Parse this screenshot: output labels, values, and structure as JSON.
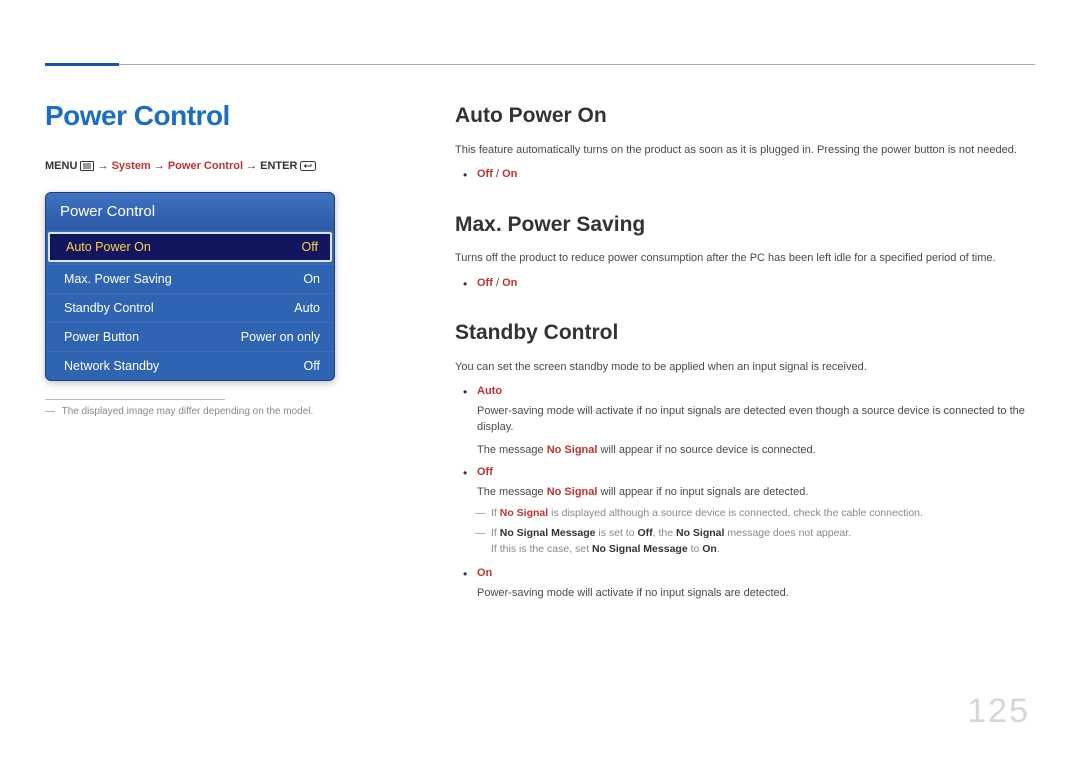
{
  "page_title": "Power Control",
  "breadcrumb": {
    "menu": "MENU",
    "arrow": "→",
    "system": "System",
    "power_control": "Power Control",
    "enter": "ENTER"
  },
  "osd": {
    "header": "Power Control",
    "items": [
      {
        "label": "Auto Power On",
        "value": "Off",
        "selected": true
      },
      {
        "label": "Max. Power Saving",
        "value": "On",
        "selected": false
      },
      {
        "label": "Standby Control",
        "value": "Auto",
        "selected": false
      },
      {
        "label": "Power Button",
        "value": "Power on only",
        "selected": false
      },
      {
        "label": "Network Standby",
        "value": "Off",
        "selected": false
      }
    ]
  },
  "footnote": "The displayed image may differ depending on the model.",
  "sections": {
    "auto_power_on": {
      "heading": "Auto Power On",
      "desc": "This feature automatically turns on the product as soon as it is plugged in. Pressing the power button is not needed.",
      "options_off": "Off",
      "sep": " / ",
      "options_on": "On"
    },
    "max_power_saving": {
      "heading": "Max. Power Saving",
      "desc": "Turns off the product to reduce power consumption after the PC has been left idle for a specified period of time.",
      "options_off": "Off",
      "sep": " / ",
      "options_on": "On"
    },
    "standby_control": {
      "heading": "Standby Control",
      "desc": "You can set the screen standby mode to be applied when an input signal is received.",
      "auto_label": "Auto",
      "auto_desc_1": "Power-saving mode will activate if no input signals are detected even though a source device is connected to the display.",
      "auto_desc_2a": "The message ",
      "auto_desc_2b": "No Signal",
      "auto_desc_2c": " will appear if no source device is connected.",
      "off_label": "Off",
      "off_desc_a": "The message ",
      "off_desc_b": "No Signal",
      "off_desc_c": " will appear if no input signals are detected.",
      "off_sub1_a": "If ",
      "off_sub1_b": "No Signal",
      "off_sub1_c": " is displayed although a source device is connected, check the cable connection.",
      "off_sub2_a": "If ",
      "off_sub2_b": "No Signal Message",
      "off_sub2_c": " is set to ",
      "off_sub2_d": "Off",
      "off_sub2_e": ", the ",
      "off_sub2_f": "No Signal",
      "off_sub2_g": " message does not appear.",
      "off_sub2_line2a": "If this is the case, set ",
      "off_sub2_line2b": "No Signal Message",
      "off_sub2_line2c": " to ",
      "off_sub2_line2d": "On",
      "off_sub2_line2e": ".",
      "on_label": "On",
      "on_desc": "Power-saving mode will activate if no input signals are detected."
    }
  },
  "page_number": "125"
}
